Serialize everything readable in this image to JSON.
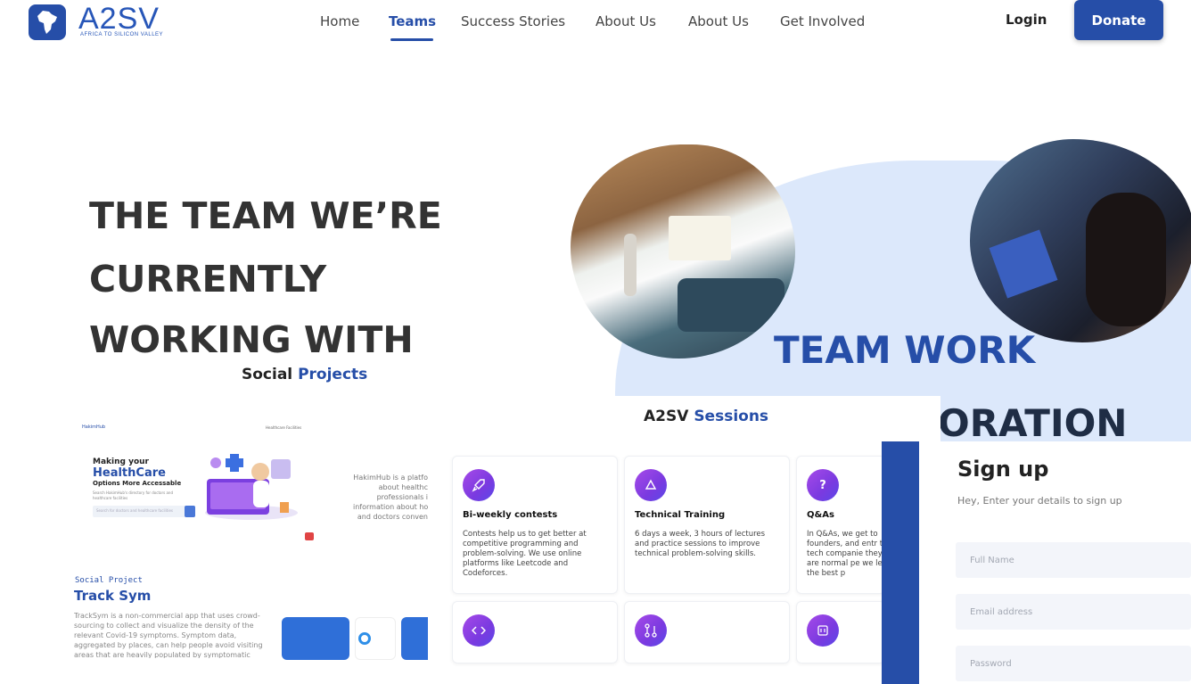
{
  "header": {
    "logo_text": "A2SV",
    "logo_sub": "AFRICA TO SILICON VALLEY",
    "nav": [
      "Home",
      "Teams",
      "Success Stories",
      "About Us",
      "About Us",
      "Get Involved"
    ],
    "active_nav": "Teams",
    "login_label": "Login",
    "donate_label": "Donate"
  },
  "hero": {
    "lines": [
      "THE TEAM WE’RE",
      "CURRENTLY",
      "WORKING WITH"
    ],
    "teamwork": "TEAM WORK",
    "oration": "ORATION"
  },
  "social": {
    "heading_a": "Social",
    "heading_b": "Projects",
    "hakimhub": {
      "logo": "HakimHub",
      "nav": "Healthcare Facilities",
      "making": "Making your",
      "health": "Health",
      "care": "Care",
      "options": "Options More Accessable",
      "small": "Search HakimHub's directory for doctors and healthcare facilities",
      "search_placeholder": "Search for doctors and healthcare facilities",
      "para_lines": [
        "HakimHub is a platfo",
        "about healthc",
        "professionals i",
        "information about ho",
        "and doctors conven"
      ]
    },
    "project": {
      "label": "Social Project",
      "title": "Track Sym",
      "desc": "TrackSym is a non-commercial app that uses crowd-sourcing to collect and visualize the density of the relevant Covid-19 symptoms. Symptom data, aggregated by places, can help people avoid visiting areas that are heavily populated by symptomatic people."
    }
  },
  "sessions": {
    "title_a": "A2SV",
    "title_b": "Sessions",
    "cards": [
      {
        "icon": "rocket-icon",
        "title": "Bi-weekly contests",
        "desc": "Contests help us to get better at competitive programming and problem-solving. We use online platforms like Leetcode and Codeforces."
      },
      {
        "icon": "triangle-icon",
        "title": "Technical Training",
        "desc": "6 days a week, 3 hours of lectures and practice sessions to improve technical problem-solving skills."
      },
      {
        "icon": "question-icon",
        "title": "Q&As",
        "desc": "In Q&As, we get to founders, and entr top tech companie they are normal pe we learn the best p"
      },
      {
        "icon": "code-icon",
        "title": "",
        "desc": ""
      },
      {
        "icon": "merge-icon",
        "title": "",
        "desc": ""
      },
      {
        "icon": "board-icon",
        "title": "",
        "desc": ""
      }
    ]
  },
  "signup": {
    "title": "Sign up",
    "subtitle": "Hey, Enter your details to sign up",
    "fullname_placeholder": "Full Name",
    "email_placeholder": "Email address",
    "password_placeholder": "Password"
  },
  "colors": {
    "primary": "#264ea8",
    "blob": "#dce8fb",
    "accent_purple": "#8a3fe6"
  }
}
